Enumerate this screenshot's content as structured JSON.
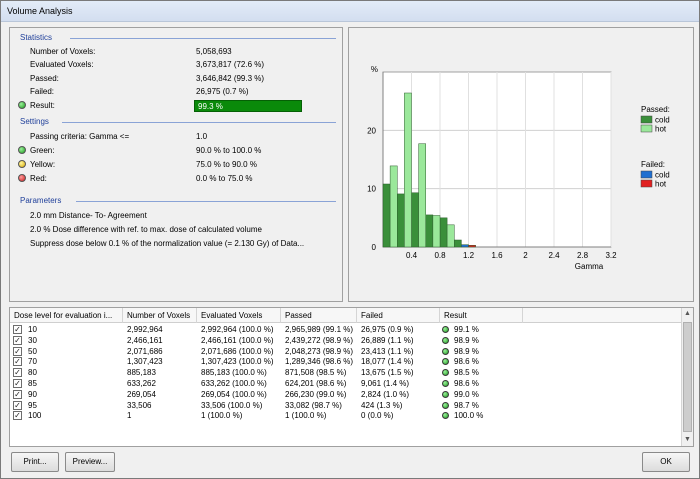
{
  "window": {
    "title": "Volume Analysis"
  },
  "statistics": {
    "title": "Statistics",
    "rows": [
      {
        "label": "Number of Voxels:",
        "value": "5,058,693"
      },
      {
        "label": "Evaluated Voxels:",
        "value": "3,673,817 (72.6 %)"
      },
      {
        "label": "Passed:",
        "value": "3,646,842 (99.3 %)"
      },
      {
        "label": "Failed:",
        "value": "26,975 (0.7 %)"
      }
    ],
    "result_label": "Result:",
    "result_value": "99.3 %"
  },
  "settings": {
    "title": "Settings",
    "criteria_label": "Passing criteria: Gamma <=",
    "criteria_value": "1.0",
    "green_label": "Green:",
    "green_value": "90.0 % to 100.0 %",
    "yellow_label": "Yellow:",
    "yellow_value": "75.0 % to 90.0 %",
    "red_label": "Red:",
    "red_value": "0.0 % to 75.0 %"
  },
  "parameters": {
    "title": "Parameters",
    "lines": [
      "2.0 mm Distance- To- Agreement",
      "2.0 % Dose difference with ref. to max. dose of calculated volume",
      "Suppress dose below 0.1 % of the normalization value (= 2.130 Gy) of Data..."
    ]
  },
  "chart_data": {
    "type": "bar",
    "ylabel": "%",
    "xlabel": "Gamma",
    "ylim": [
      0,
      30
    ],
    "xlim": [
      0,
      3.2
    ],
    "y_ticks": [
      "0",
      "10",
      "20"
    ],
    "x_ticks": [
      "0.4",
      "0.8",
      "1.2",
      "1.6",
      "2",
      "2.4",
      "2.8",
      "3.2"
    ],
    "bin_width": 0.1,
    "series": [
      {
        "name": "cold",
        "group": "Passed",
        "color": "#3a8f3a",
        "x": [
          0.05,
          0.25,
          0.45,
          0.65,
          0.85,
          1.05
        ],
        "values": [
          10.8,
          9.1,
          9.3,
          5.5,
          5.0,
          1.2
        ]
      },
      {
        "name": "hot",
        "group": "Passed",
        "color": "#9be89b",
        "x": [
          0.15,
          0.35,
          0.55,
          0.75,
          0.95
        ],
        "values": [
          13.9,
          26.4,
          17.7,
          5.4,
          3.8
        ]
      },
      {
        "name": "cold",
        "group": "Failed",
        "color": "#1f6fd0",
        "x": [
          1.15
        ],
        "values": [
          0.4
        ]
      },
      {
        "name": "hot",
        "group": "Failed",
        "color": "#e02020",
        "x": [
          1.25
        ],
        "values": [
          0.3
        ]
      }
    ],
    "legend": {
      "passed_title": "Passed:",
      "failed_title": "Failed:",
      "items": [
        {
          "group": "passed",
          "label": "cold",
          "color": "#3a8f3a"
        },
        {
          "group": "passed",
          "label": "hot",
          "color": "#9be89b"
        },
        {
          "group": "failed",
          "label": "cold",
          "color": "#1f6fd0"
        },
        {
          "group": "failed",
          "label": "hot",
          "color": "#e02020"
        }
      ]
    }
  },
  "table": {
    "columns": [
      "Dose level for evaluation i...",
      "Number of Voxels",
      "Evaluated Voxels",
      "Passed",
      "Failed",
      "Result"
    ],
    "rows": [
      {
        "dose": "10",
        "voxels": "2,992,964",
        "evaluated": "2,992,964 (100.0 %)",
        "passed": "2,965,989 (99.1 %)",
        "failed": "26,975 (0.9 %)",
        "result": "99.1 %"
      },
      {
        "dose": "30",
        "voxels": "2,466,161",
        "evaluated": "2,466,161 (100.0 %)",
        "passed": "2,439,272 (98.9 %)",
        "failed": "26,889 (1.1 %)",
        "result": "98.9 %"
      },
      {
        "dose": "50",
        "voxels": "2,071,686",
        "evaluated": "2,071,686 (100.0 %)",
        "passed": "2,048,273 (98.9 %)",
        "failed": "23,413 (1.1 %)",
        "result": "98.9 %"
      },
      {
        "dose": "70",
        "voxels": "1,307,423",
        "evaluated": "1,307,423 (100.0 %)",
        "passed": "1,289,346 (98.6 %)",
        "failed": "18,077 (1.4 %)",
        "result": "98.6 %"
      },
      {
        "dose": "80",
        "voxels": "885,183",
        "evaluated": "885,183 (100.0 %)",
        "passed": "871,508 (98.5 %)",
        "failed": "13,675 (1.5 %)",
        "result": "98.5 %"
      },
      {
        "dose": "85",
        "voxels": "633,262",
        "evaluated": "633,262 (100.0 %)",
        "passed": "624,201 (98.6 %)",
        "failed": "9,061 (1.4 %)",
        "result": "98.6 %"
      },
      {
        "dose": "90",
        "voxels": "269,054",
        "evaluated": "269,054 (100.0 %)",
        "passed": "266,230 (99.0 %)",
        "failed": "2,824 (1.0 %)",
        "result": "99.0 %"
      },
      {
        "dose": "95",
        "voxels": "33,506",
        "evaluated": "33,506 (100.0 %)",
        "passed": "33,082 (98.7 %)",
        "failed": "424 (1.3 %)",
        "result": "98.7 %"
      },
      {
        "dose": "100",
        "voxels": "1",
        "evaluated": "1 (100.0 %)",
        "passed": "1 (100.0 %)",
        "failed": "0 (0.0 %)",
        "result": "100.0 %"
      }
    ]
  },
  "buttons": {
    "print": "Print...",
    "preview": "Preview...",
    "ok": "OK"
  }
}
